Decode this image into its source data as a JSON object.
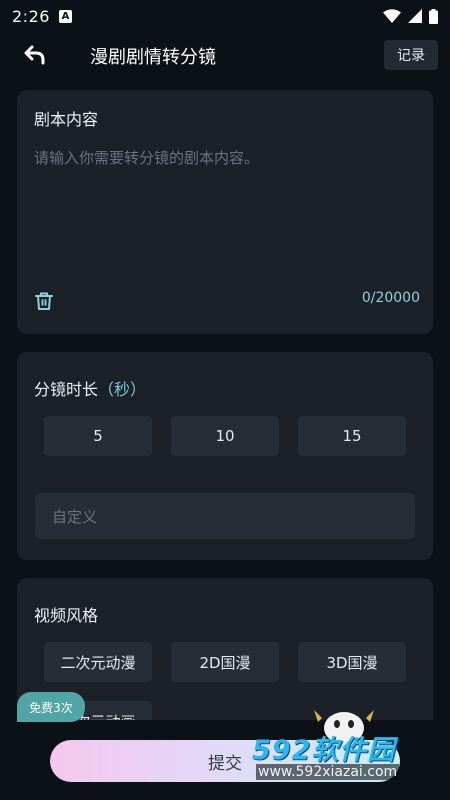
{
  "status_bar": {
    "time": "2:26",
    "notification_glyph": "A",
    "icons": [
      "wifi-icon",
      "signal-icon",
      "battery-icon"
    ]
  },
  "header": {
    "title": "漫剧剧情转分镜",
    "record_label": "记录"
  },
  "script_card": {
    "title": "剧本内容",
    "placeholder": "请输入你需要转分镜的剧本内容。",
    "char_count": "0/20000"
  },
  "duration_card": {
    "title": "分镜时长",
    "unit": "（秒）",
    "options": [
      "5",
      "10",
      "15"
    ],
    "custom_placeholder": "自定义"
  },
  "style_card": {
    "title": "视频风格",
    "options": [
      "二次元动漫",
      "2D国漫",
      "3D国漫",
      "二次元动画"
    ]
  },
  "bottom": {
    "submit_label": "提交",
    "free_badge": "免费3次"
  },
  "watermark": {
    "brand": "592软件园",
    "url": "www.592xiazai.com"
  },
  "colors": {
    "background": "#0b1117",
    "card": "#1c2129",
    "button": "#262d37",
    "accent": "#8fd3d9",
    "badge": "#52a5a7"
  }
}
